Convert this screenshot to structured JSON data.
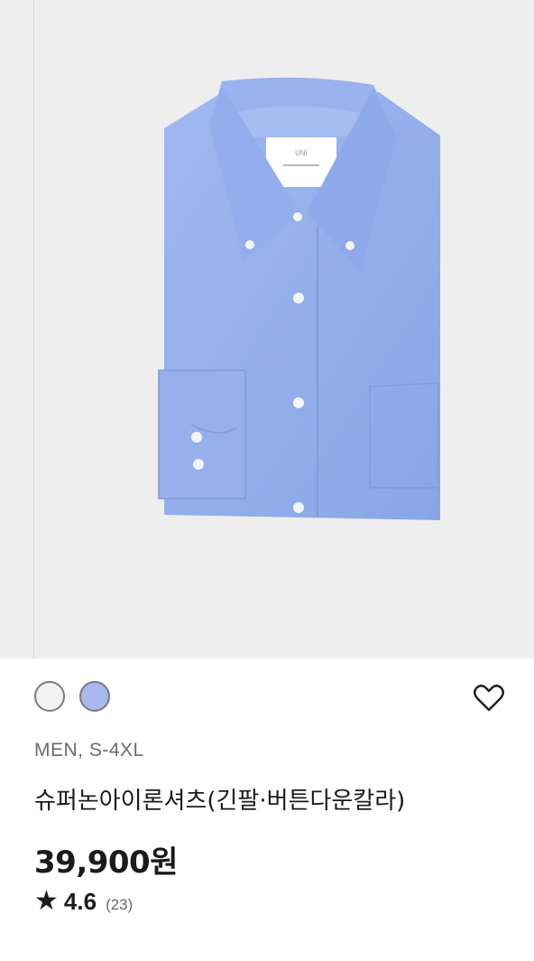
{
  "product": {
    "image_alt": "shirt-image",
    "colors": [
      {
        "name": "white",
        "hex": "#f2f2f2"
      },
      {
        "name": "blue",
        "hex": "#a9b7ee"
      }
    ],
    "gender_size": "MEN, S-4XL",
    "name": "슈퍼논아이론셔츠(긴팔·버튼다운칼라)",
    "price": "39,900원",
    "rating": {
      "star": "★",
      "value": "4.6",
      "count": "(23)"
    }
  },
  "icons": {
    "favorite": "heart-outline-icon"
  },
  "theme": {
    "image_background": "#eeeeef",
    "shirt_color": "#90acec"
  }
}
